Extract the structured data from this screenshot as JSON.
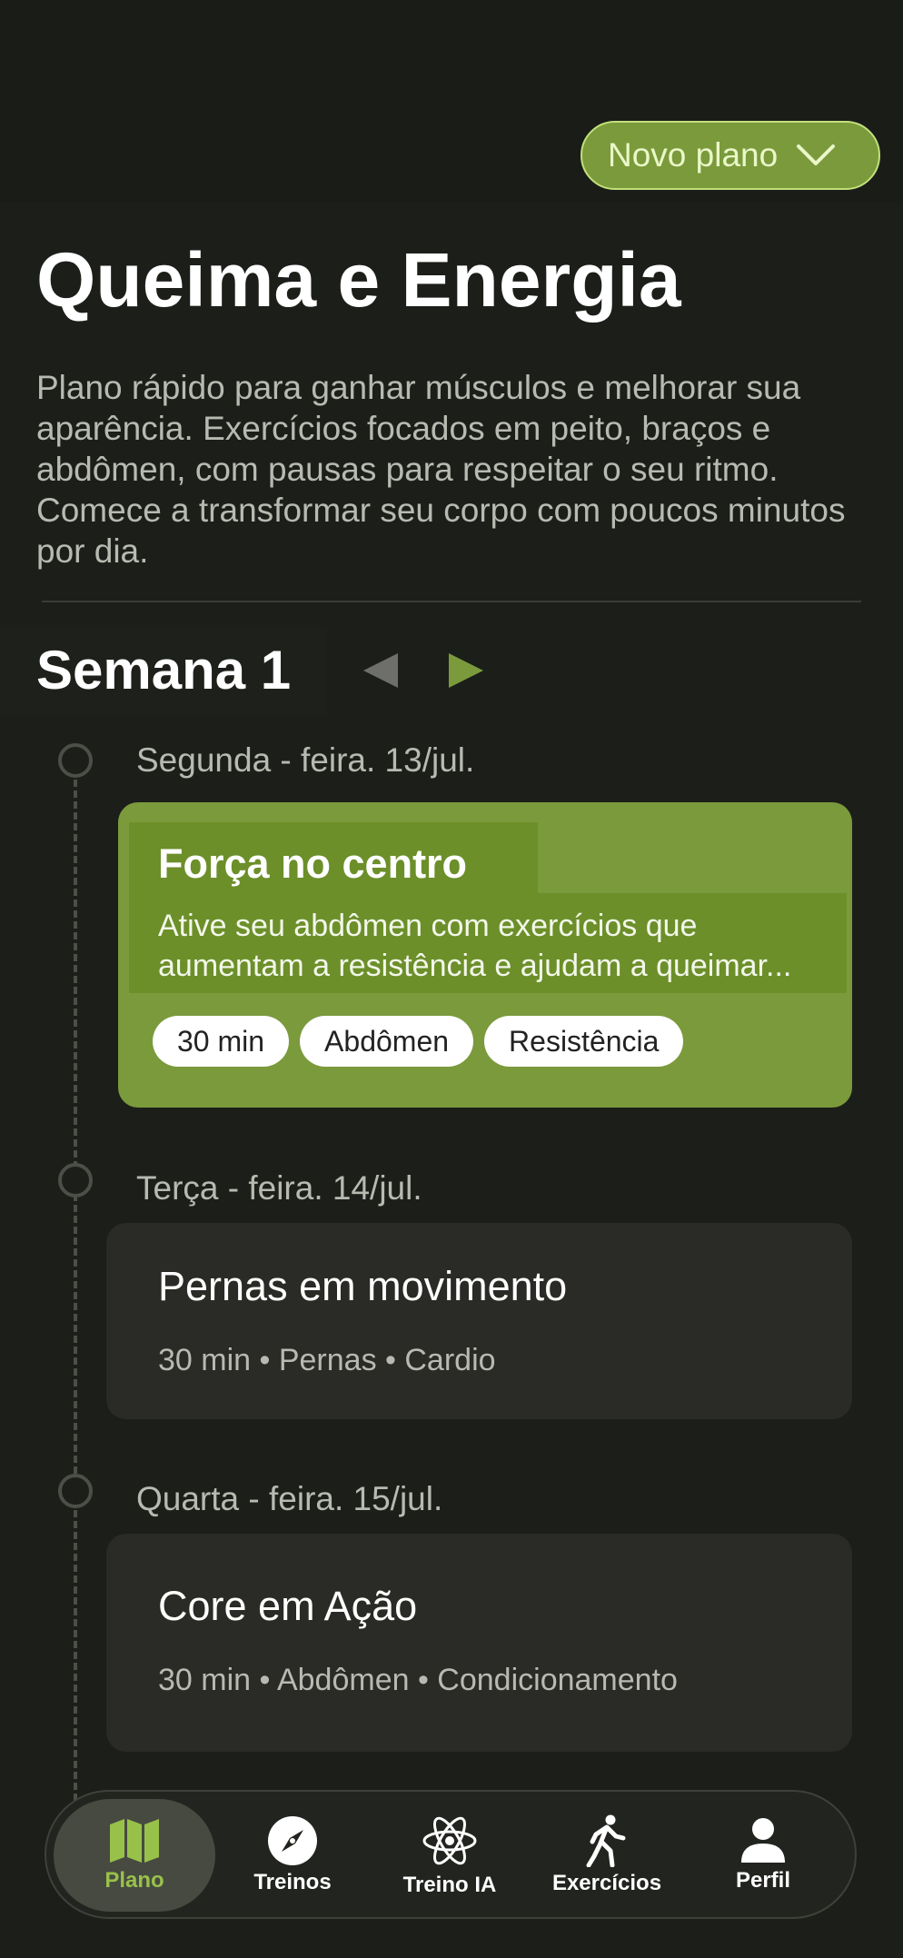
{
  "colors": {
    "background": "#1c1e1a",
    "accent": "#7a9a3c",
    "accent_light": "#98c14a",
    "card": "#2a2a26",
    "muted_text": "#b8bab2"
  },
  "header": {
    "new_plan_label": "Novo plano",
    "new_plan_icon": "chevron-down-icon"
  },
  "plan": {
    "title": "Queima e Energia",
    "description": "Plano rápido para ganhar músculos e melhorar sua aparência. Exercícios focados em peito, braços e abdômen, com pausas para respeitar o seu ritmo. Comece a transformar seu corpo com poucos minutos por dia."
  },
  "week": {
    "title": "Semana 1",
    "prev_icon": "triangle-left-icon",
    "next_icon": "triangle-right-icon"
  },
  "days": [
    {
      "label": "Segunda - feira. 13/jul.",
      "workout_title": "Força no centro",
      "workout_desc": "Ative seu abdômen com exercícios que aumentam a resistência e ajudam a queimar...",
      "tags": [
        "30 min",
        "Abdômen",
        "Resistência"
      ]
    },
    {
      "label": "Terça - feira. 14/jul.",
      "workout_title": "Pernas em movimento",
      "workout_meta": "30 min • Pernas • Cardio"
    },
    {
      "label": "Quarta - feira. 15/jul.",
      "workout_title": "Core em Ação",
      "workout_meta": "30 min • Abdômen • Condicionamento"
    }
  ],
  "nav": [
    {
      "label": "Plano",
      "icon": "map-icon",
      "active": true
    },
    {
      "label": "Treinos",
      "icon": "compass-icon",
      "active": false
    },
    {
      "label": "Treino IA",
      "icon": "atom-icon",
      "active": false
    },
    {
      "label": "Exercícios",
      "icon": "walking-person-icon",
      "active": false
    },
    {
      "label": "Perfil",
      "icon": "person-icon",
      "active": false
    }
  ]
}
